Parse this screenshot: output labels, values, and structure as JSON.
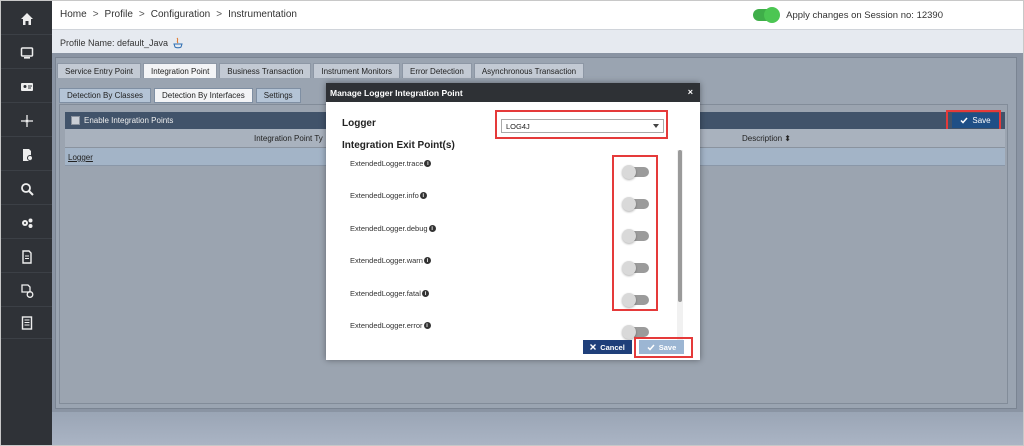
{
  "breadcrumb": [
    "Home",
    "Profile",
    "Configuration",
    "Instrumentation"
  ],
  "breadcrumb_separator": ">",
  "session": {
    "label": "Apply changes on Session no: 12390",
    "toggle_on": true
  },
  "profile": {
    "label": "Profile Name: default_Java"
  },
  "tabs": [
    {
      "label": "Service Entry Point"
    },
    {
      "label": "Integration Point"
    },
    {
      "label": "Business Transaction"
    },
    {
      "label": "Instrument Monitors"
    },
    {
      "label": "Error Detection"
    },
    {
      "label": "Asynchronous Transaction"
    }
  ],
  "subtabs": [
    {
      "label": "Detection By Classes"
    },
    {
      "label": "Detection By Interfaces"
    },
    {
      "label": "Settings"
    }
  ],
  "table": {
    "enable_label": "Enable Integration Points",
    "save_label": "Save",
    "col_type": "Integration Point Ty",
    "col_description": "Description",
    "sort_icon": "⬍",
    "row1_name": "Logger"
  },
  "modal": {
    "title": "Manage Logger Integration Point",
    "close": "×",
    "logger_label": "Logger",
    "logger_value": "LOG4J",
    "exit_points_label": "Integration Exit Point(s)",
    "exit_points": [
      {
        "name": "ExtendedLogger.trace",
        "enabled": false
      },
      {
        "name": "ExtendedLogger.info",
        "enabled": false
      },
      {
        "name": "ExtendedLogger.debug",
        "enabled": false
      },
      {
        "name": "ExtendedLogger.warn",
        "enabled": false
      },
      {
        "name": "ExtendedLogger.fatal",
        "enabled": false
      },
      {
        "name": "ExtendedLogger.error",
        "enabled": false
      }
    ],
    "info_glyph": "i",
    "cancel_label": "Cancel",
    "save_label": "Save"
  },
  "colors": {
    "sidebar": "#2f3237",
    "highlight": "#e53a3a",
    "primary_button": "#1f3f7a",
    "toggle_on": "#3fae49"
  }
}
